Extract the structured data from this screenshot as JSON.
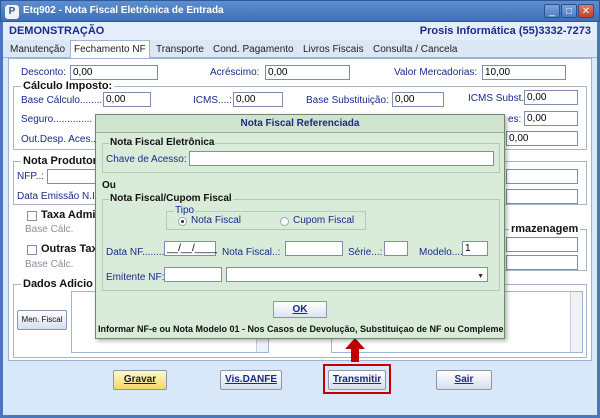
{
  "window": {
    "title": "Etq902 - Nota Fiscal Eletrônica de Entrada",
    "icon_letter": "P",
    "minimize_glyph": "_",
    "maximize_glyph": "□",
    "close_glyph": "✕"
  },
  "company": {
    "left": "DEMONSTRAÇÃO",
    "right": "Prosis Informática (55)3332-7273"
  },
  "tabs": [
    {
      "label": "Manutenção"
    },
    {
      "label": "Fechamento NF"
    },
    {
      "label": "Transporte"
    },
    {
      "label": "Cond. Pagamento"
    },
    {
      "label": "Livros Fiscais"
    },
    {
      "label": "Consulta / Cancela"
    }
  ],
  "totals": {
    "desconto_label": "Desconto:",
    "desconto_value": "0,00",
    "acrescimo_label": "Acréscimo:",
    "acrescimo_value": "0,00",
    "valor_merc_label": "Valor Mercadorias:",
    "valor_merc_value": "10,00"
  },
  "calculo": {
    "title": "Cálculo Imposto:",
    "base_calculo_label": "Base Cálculo.........:",
    "base_calculo_value": "0,00",
    "icms_label": "ICMS....:",
    "icms_value": "0,00",
    "base_subst_label": "Base Substituição:",
    "base_subst_value": "0,00",
    "icms_subst_label": "ICMS Subst.:",
    "icms_subst_value": "0,00",
    "seguro_label": "Seguro..............",
    "outras_label": "es:",
    "outras_value": "0,00",
    "outdesp_label": "Out.Desp. Aces...",
    "outdesp_value": "0,00"
  },
  "produtor": {
    "title": "Nota Produtor",
    "nfp_label": "NFP..:",
    "data_label": "Data Emissão N.I"
  },
  "taxa": {
    "title": "Taxa Admi",
    "base_label": "Base Cálc."
  },
  "outras_tax": {
    "title": "Outras Tax",
    "base_label": "Base Cálc."
  },
  "armazenagem": {
    "title": "rmazenagem"
  },
  "dados": {
    "title": "Dados Adicio",
    "men_fiscal_button": "Men. Fiscal"
  },
  "dialog": {
    "title": "Nota Fiscal Referenciada",
    "nfe_group": "Nota Fiscal Eletrônica",
    "chave_label": "Chave de Acesso:",
    "chave_value": "",
    "ou_label": "Ou",
    "cupom_group": "Nota Fiscal/Cupom Fiscal",
    "tipo_label": "Tipo",
    "radio_nota": "Nota Fiscal",
    "radio_cupom": "Cupom Fiscal",
    "data_nf_label": "Data NF..........",
    "data_nf_value": "__/__/____",
    "nota_fiscal_label": "Nota Fiscal..:",
    "nota_fiscal_value": "",
    "serie_label": "Série...:",
    "serie_value": "",
    "modelo_label": "Modelo....",
    "modelo_value": "1",
    "emitente_label": "Emitente NF:",
    "emitente_code": "",
    "emitente_name": "",
    "ok_button": "OK",
    "info": "Informar NF-e ou Nota Modelo 01 - Nos Casos de Devolução, Substituiçao de NF ou Complementação de ICMS"
  },
  "buttons": {
    "gravar": "Gravar",
    "vis_danfe": "Vis.DANFE",
    "transmitir": "Transmitir",
    "sair": "Sair"
  },
  "colors": {
    "accent_red": "#c00000",
    "dialog_bg": "#d9ecd9"
  }
}
